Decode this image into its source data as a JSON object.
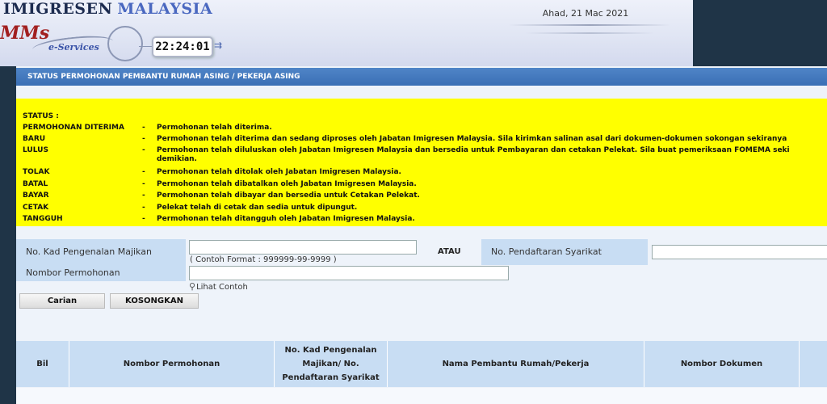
{
  "header": {
    "brand_part1": "IMIGRESEN",
    "brand_part2": "MALAYSIA",
    "logo_mms": "MMs",
    "logo_eservices": "e-Services",
    "clock": "22:24:01",
    "date": "Ahad, 21 Mac 2021"
  },
  "panel": {
    "title": "STATUS PERMOHONAN PEMBANTU RUMAH ASING / PEKERJA ASING"
  },
  "status": {
    "heading": "STATUS :",
    "items": [
      {
        "label": "PERMOHONAN DITERIMA",
        "dash": "-",
        "desc": "Permohonan telah diterima."
      },
      {
        "label": "BARU",
        "dash": "-",
        "desc": "Permohonan telah diterima dan sedang diproses oleh Jabatan Imigresen Malaysia. Sila kirimkan salinan asal dari dokumen-dokumen sokongan sekiranya"
      },
      {
        "label": "LULUS",
        "dash": "-",
        "desc": "Permohonan telah diluluskan oleh Jabatan Imigresen Malaysia dan bersedia untuk Pembayaran dan cetakan Pelekat. Sila buat pemeriksaan FOMEMA seki",
        "desc2": "demikian."
      },
      {
        "label": "TOLAK",
        "dash": "-",
        "desc": "Permohonan telah ditolak oleh Jabatan Imigresen Malaysia."
      },
      {
        "label": "BATAL",
        "dash": "-",
        "desc": "Permohonan telah dibatalkan oleh Jabatan Imigresen Malaysia."
      },
      {
        "label": "BAYAR",
        "dash": "-",
        "desc": "Permohonan telah dibayar dan bersedia untuk Cetakan Pelekat."
      },
      {
        "label": "CETAK",
        "dash": "-",
        "desc": "Pelekat telah di cetak dan sedia untuk dipungut."
      },
      {
        "label": "TANGGUH",
        "dash": "-",
        "desc": "Permohonan telah ditangguh oleh Jabatan Imigresen Malaysia."
      }
    ]
  },
  "form": {
    "kad_label": "No. Kad Pengenalan Majikan",
    "kad_value": "",
    "kad_hint": "( Contoh Format : 999999-99-9999 )",
    "atau": "ATAU",
    "syarikat_label": "No. Pendaftaran Syarikat",
    "syarikat_value": "",
    "permohonan_label": "Nombor Permohonan",
    "permohonan_value": "",
    "lihat_contoh": "Lihat Contoh",
    "carian_button": "Carian",
    "kosongkan_button": "KOSONGKAN"
  },
  "table": {
    "col_bil": "Bil",
    "col_nombor": "Nombor Permohonan",
    "col_kad_l1": "No. Kad Pengenalan",
    "col_kad_l2": "Majikan/ No.",
    "col_kad_l3": "Pendaftaran Syarikat",
    "col_nama": "Nama Pembantu Rumah/Pekerja",
    "col_dokumen": "Nombor Dokumen"
  }
}
